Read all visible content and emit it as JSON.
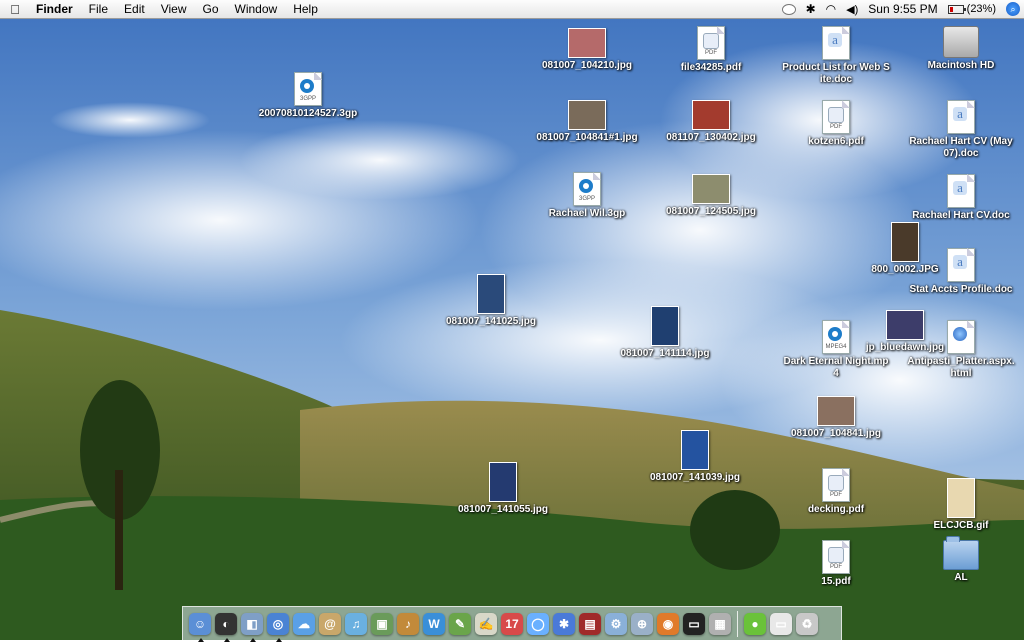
{
  "menubar": {
    "app": "Finder",
    "menus": [
      "File",
      "Edit",
      "View",
      "Go",
      "Window",
      "Help"
    ],
    "clock": "Sun 9:55 PM",
    "battery": "(23%)"
  },
  "desktop_icons": [
    {
      "label": "081007_104210.jpg",
      "kind": "photo",
      "color": "#b56a6a"
    },
    {
      "label": "file34285.pdf",
      "kind": "pdf"
    },
    {
      "label": "Product List for Web Site.doc",
      "kind": "word"
    },
    {
      "label": "Macintosh HD",
      "kind": "harddisk"
    },
    {
      "label": "20070810124527.3gp",
      "kind": "quicktime"
    },
    {
      "label": "081007_104841#1.jpg",
      "kind": "photo",
      "color": "#7a6b5a"
    },
    {
      "label": "081107_130402.jpg",
      "kind": "photo",
      "color": "#a33b2e"
    },
    {
      "label": "kotzen6.pdf",
      "kind": "pdf"
    },
    {
      "label": "Rachael Hart CV (May 07).doc",
      "kind": "word"
    },
    {
      "label": "Rachael Wil.3gp",
      "kind": "quicktime"
    },
    {
      "label": "081007_124505.jpg",
      "kind": "photo",
      "color": "#8d8d6e"
    },
    {
      "label": "Rachael Hart CV.doc",
      "kind": "word"
    },
    {
      "label": "800_0002.JPG",
      "kind": "photo-tall",
      "color": "#4a3a2a"
    },
    {
      "label": "Stat Accts Profile.doc",
      "kind": "word"
    },
    {
      "label": "081007_141025.jpg",
      "kind": "photo-tall",
      "color": "#2a4a7a"
    },
    {
      "label": "081007_141114.jpg",
      "kind": "photo-tall",
      "color": "#1f3f70"
    },
    {
      "label": "Dark Eternal Night.mp4",
      "kind": "mpeg4"
    },
    {
      "label": "jp_bluedawn.jpg",
      "kind": "photo",
      "color": "#3d3d6a"
    },
    {
      "label": "Antipasti_Platter.aspx.html",
      "kind": "web"
    },
    {
      "label": "081007_104841.jpg",
      "kind": "photo",
      "color": "#8a7060"
    },
    {
      "label": "081007_141039.jpg",
      "kind": "photo-tall",
      "color": "#2453a0"
    },
    {
      "label": "081007_141055.jpg",
      "kind": "photo-tall",
      "color": "#243a70"
    },
    {
      "label": "decking.pdf",
      "kind": "pdf"
    },
    {
      "label": "ELCJCB.gif",
      "kind": "photo-tall",
      "color": "#e8d8b0"
    },
    {
      "label": "15.pdf",
      "kind": "pdf"
    },
    {
      "label": "AL",
      "kind": "folder"
    }
  ],
  "dock": {
    "apps": [
      {
        "name": "finder",
        "color": "#5b8fd6",
        "glyph": "☺",
        "running": true
      },
      {
        "name": "dashboard",
        "color": "#333",
        "glyph": "◐",
        "running": true
      },
      {
        "name": "preview",
        "color": "#7f9fc6",
        "glyph": "◧",
        "running": true
      },
      {
        "name": "safari",
        "color": "#4a83d4",
        "glyph": "◎",
        "running": true
      },
      {
        "name": "ichat",
        "color": "#5aa0e6",
        "glyph": "☁",
        "running": false
      },
      {
        "name": "address-book",
        "color": "#c9a76a",
        "glyph": "@",
        "running": false
      },
      {
        "name": "itunes",
        "color": "#6ab0e0",
        "glyph": "♫",
        "running": false
      },
      {
        "name": "iphoto",
        "color": "#6a9b5a",
        "glyph": "▣",
        "running": false
      },
      {
        "name": "garageband",
        "color": "#c28a3a",
        "glyph": "♪",
        "running": false
      },
      {
        "name": "iweb",
        "color": "#3a8fd8",
        "glyph": "W",
        "running": false
      },
      {
        "name": "script-editor",
        "color": "#6aa54a",
        "glyph": "✎",
        "running": false
      },
      {
        "name": "textedit",
        "color": "#d8d8c8",
        "glyph": "✍",
        "running": false
      },
      {
        "name": "ical",
        "color": "#d84a4a",
        "glyph": "17",
        "running": false
      },
      {
        "name": "spotlight",
        "color": "#6ab0ff",
        "glyph": "◯",
        "running": false
      },
      {
        "name": "bluetooth",
        "color": "#4a7ad8",
        "glyph": "✱",
        "running": false
      },
      {
        "name": "photo-booth",
        "color": "#a02a2a",
        "glyph": "▤",
        "running": false
      },
      {
        "name": "automator",
        "color": "#8ab0d8",
        "glyph": "⚙",
        "running": false
      },
      {
        "name": "network",
        "color": "#9ab0c8",
        "glyph": "⊕",
        "running": false
      },
      {
        "name": "firefox",
        "color": "#e07a2a",
        "glyph": "◉",
        "running": false
      },
      {
        "name": "terminal",
        "color": "#222",
        "glyph": "▭",
        "running": false
      },
      {
        "name": "system-profiler",
        "color": "#b0b0b0",
        "glyph": "▦",
        "running": false
      }
    ],
    "right": [
      {
        "name": "growl",
        "color": "#6ac23a",
        "glyph": "●",
        "running": false
      },
      {
        "name": "mail-stack",
        "color": "#e8e8e8",
        "glyph": "▭",
        "running": false
      },
      {
        "name": "trash",
        "color": "#c8c8c8",
        "glyph": "♻",
        "running": false
      }
    ]
  }
}
